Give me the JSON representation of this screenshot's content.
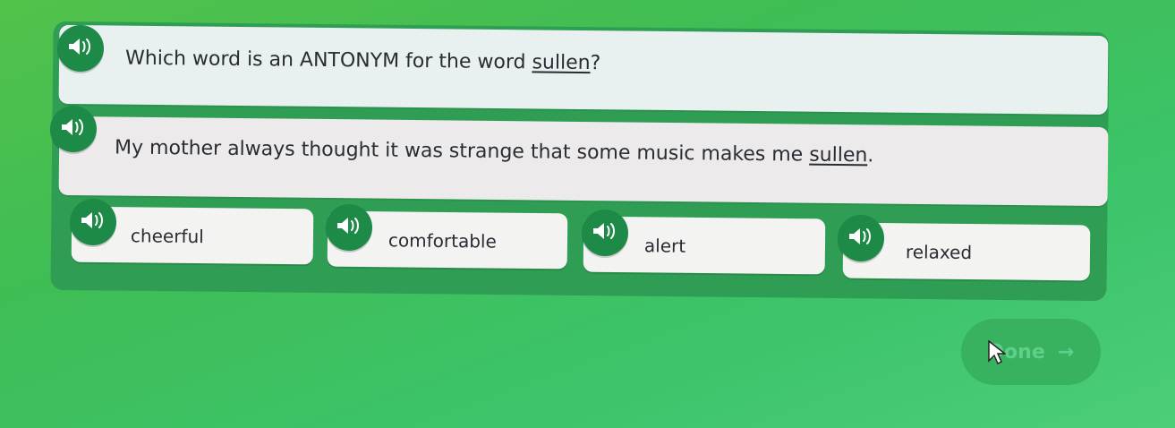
{
  "question": {
    "prefix": "Which word is an ANTONYM for the word ",
    "target_word": "sullen",
    "suffix": "?"
  },
  "sentence": {
    "prefix": "My mother always thought it was strange that some music makes me ",
    "target_word": "sullen",
    "suffix": "."
  },
  "options": [
    {
      "label": "cheerful"
    },
    {
      "label": "comfortable"
    },
    {
      "label": "alert"
    },
    {
      "label": "relaxed"
    }
  ],
  "done_button": {
    "label": "Done",
    "icon": "arrow-right-icon"
  },
  "icons": {
    "audio": "speaker-icon"
  },
  "colors": {
    "accent": "#1e8a47",
    "background": "#3fbd55"
  }
}
